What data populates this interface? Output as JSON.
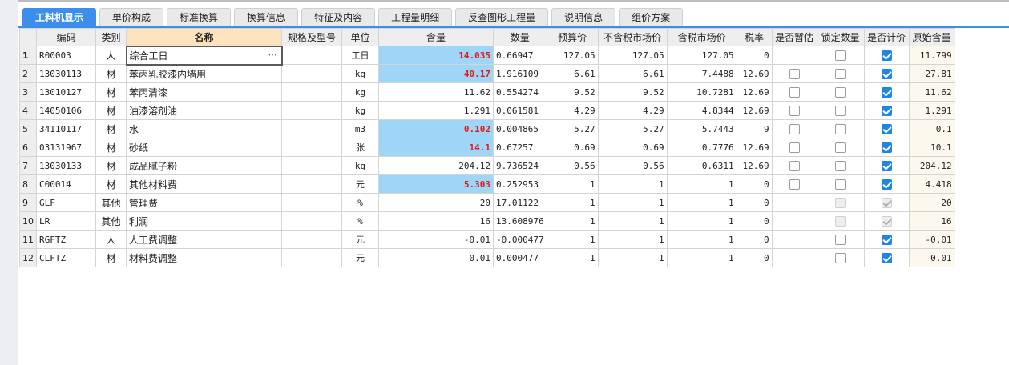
{
  "tabs": [
    {
      "label": "工料机显示",
      "active": true
    },
    {
      "label": "单价构成",
      "active": false
    },
    {
      "label": "标准换算",
      "active": false
    },
    {
      "label": "换算信息",
      "active": false
    },
    {
      "label": "特征及内容",
      "active": false
    },
    {
      "label": "工程量明细",
      "active": false
    },
    {
      "label": "反查图形工程量",
      "active": false
    },
    {
      "label": "说明信息",
      "active": false
    },
    {
      "label": "组价方案",
      "active": false
    }
  ],
  "columns": [
    "编码",
    "类别",
    "名称",
    "规格及型号",
    "单位",
    "含量",
    "数量",
    "预算价",
    "不含税市场价",
    "含税市场价",
    "税率",
    "是否暂估",
    "锁定数量",
    "是否计价",
    "原始含量"
  ],
  "rows": [
    {
      "n": "1",
      "code": "R00003",
      "cat": "人",
      "name": "综合工日",
      "spec": "",
      "unit": "工日",
      "qty": "14.035",
      "amount": "0.66947",
      "budget": "127.05",
      "notax": "127.05",
      "tax": "127.05",
      "rate": "0",
      "zg": "none",
      "lock": "unchecked",
      "price": "checked",
      "orig": "11.799",
      "hl": true,
      "sel": true
    },
    {
      "n": "2",
      "code": "13030113",
      "cat": "材",
      "name": "苯丙乳胶漆内墙用",
      "spec": "",
      "unit": "kg",
      "qty": "40.17",
      "amount": "1.916109",
      "budget": "6.61",
      "notax": "6.61",
      "tax": "7.4488",
      "rate": "12.69",
      "zg": "unchecked",
      "lock": "unchecked",
      "price": "checked",
      "orig": "27.81",
      "hl": true,
      "sel": false
    },
    {
      "n": "3",
      "code": "13010127",
      "cat": "材",
      "name": "苯丙清漆",
      "spec": "",
      "unit": "kg",
      "qty": "11.62",
      "amount": "0.554274",
      "budget": "9.52",
      "notax": "9.52",
      "tax": "10.7281",
      "rate": "12.69",
      "zg": "unchecked",
      "lock": "unchecked",
      "price": "checked",
      "orig": "11.62",
      "hl": false,
      "sel": false
    },
    {
      "n": "4",
      "code": "14050106",
      "cat": "材",
      "name": "油漆溶剂油",
      "spec": "",
      "unit": "kg",
      "qty": "1.291",
      "amount": "0.061581",
      "budget": "4.29",
      "notax": "4.29",
      "tax": "4.8344",
      "rate": "12.69",
      "zg": "unchecked",
      "lock": "unchecked",
      "price": "checked",
      "orig": "1.291",
      "hl": false,
      "sel": false
    },
    {
      "n": "5",
      "code": "34110117",
      "cat": "材",
      "name": "水",
      "spec": "",
      "unit": "m3",
      "qty": "0.102",
      "amount": "0.004865",
      "budget": "5.27",
      "notax": "5.27",
      "tax": "5.7443",
      "rate": "9",
      "zg": "unchecked",
      "lock": "unchecked",
      "price": "checked",
      "orig": "0.1",
      "hl": true,
      "sel": false
    },
    {
      "n": "6",
      "code": "03131967",
      "cat": "材",
      "name": "砂纸",
      "spec": "",
      "unit": "张",
      "qty": "14.1",
      "amount": "0.67257",
      "budget": "0.69",
      "notax": "0.69",
      "tax": "0.7776",
      "rate": "12.69",
      "zg": "unchecked",
      "lock": "unchecked",
      "price": "checked",
      "orig": "10.1",
      "hl": true,
      "sel": false
    },
    {
      "n": "7",
      "code": "13030133",
      "cat": "材",
      "name": "成品腻子粉",
      "spec": "",
      "unit": "kg",
      "qty": "204.12",
      "amount": "9.736524",
      "budget": "0.56",
      "notax": "0.56",
      "tax": "0.6311",
      "rate": "12.69",
      "zg": "unchecked",
      "lock": "unchecked",
      "price": "checked",
      "orig": "204.12",
      "hl": false,
      "sel": false
    },
    {
      "n": "8",
      "code": "C00014",
      "cat": "材",
      "name": "其他材料费",
      "spec": "",
      "unit": "元",
      "qty": "5.303",
      "amount": "0.252953",
      "budget": "1",
      "notax": "1",
      "tax": "1",
      "rate": "0",
      "zg": "unchecked",
      "lock": "unchecked",
      "price": "checked",
      "orig": "4.418",
      "hl": true,
      "sel": false
    },
    {
      "n": "9",
      "code": "GLF",
      "cat": "其他",
      "name": "管理费",
      "spec": "",
      "unit": "%",
      "qty": "20",
      "amount": "17.01122",
      "budget": "1",
      "notax": "1",
      "tax": "1",
      "rate": "0",
      "zg": "none",
      "lock": "disabled",
      "price": "disabled-checked",
      "orig": "20",
      "hl": false,
      "sel": false
    },
    {
      "n": "10",
      "code": "LR",
      "cat": "其他",
      "name": "利润",
      "spec": "",
      "unit": "%",
      "qty": "16",
      "amount": "13.608976",
      "budget": "1",
      "notax": "1",
      "tax": "1",
      "rate": "0",
      "zg": "none",
      "lock": "disabled",
      "price": "disabled-checked",
      "orig": "16",
      "hl": false,
      "sel": false
    },
    {
      "n": "11",
      "code": "RGFTZ",
      "cat": "人",
      "name": "人工费调整",
      "spec": "",
      "unit": "元",
      "qty": "-0.01",
      "amount": "-0.000477",
      "budget": "1",
      "notax": "1",
      "tax": "1",
      "rate": "0",
      "zg": "none",
      "lock": "unchecked",
      "price": "checked",
      "orig": "-0.01",
      "hl": false,
      "sel": false
    },
    {
      "n": "12",
      "code": "CLFTZ",
      "cat": "材",
      "name": "材料费调整",
      "spec": "",
      "unit": "元",
      "qty": "0.01",
      "amount": "0.000477",
      "budget": "1",
      "notax": "1",
      "tax": "1",
      "rate": "0",
      "zg": "none",
      "lock": "unchecked",
      "price": "checked",
      "orig": "0.01",
      "hl": false,
      "sel": false
    }
  ],
  "colors": {
    "tab_active": "#3d8ee8",
    "qty_highlight_bg": "#9fd6f7",
    "qty_highlight_text": "#e11a1a",
    "name_header_bg": "#fde3bd"
  },
  "icons": {
    "ellipsis": "ellipsis-icon",
    "checkbox": "checkbox-icon"
  }
}
